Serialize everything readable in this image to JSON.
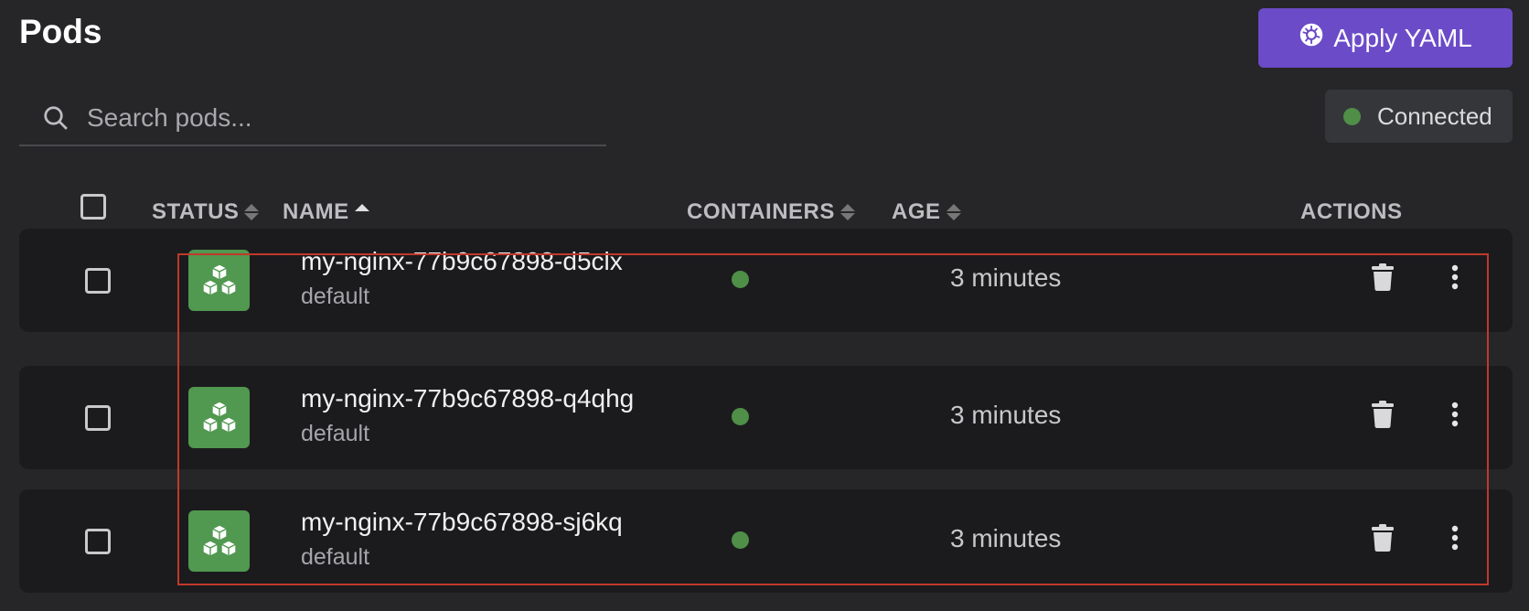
{
  "page": {
    "title": "Pods",
    "apply_button_label": "Apply YAML",
    "search_placeholder": "Search pods...",
    "connection_status": "Connected"
  },
  "colors": {
    "background": "#262628",
    "row_background": "#1b1b1d",
    "accent_purple": "#6b4bc8",
    "status_green": "#4f8f48",
    "pod_icon_green": "#519850",
    "highlight_red": "#c0392b"
  },
  "table": {
    "columns": {
      "status": "STATUS",
      "name": "NAME",
      "containers": "CONTAINERS",
      "age": "AGE",
      "actions": "ACTIONS"
    },
    "sorted_by": "name",
    "rows": [
      {
        "name": "my-nginx-77b9c67898-d5clx",
        "namespace": "default",
        "age": "3 minutes",
        "container_status": "running"
      },
      {
        "name": "my-nginx-77b9c67898-q4qhg",
        "namespace": "default",
        "age": "3 minutes",
        "container_status": "running"
      },
      {
        "name": "my-nginx-77b9c67898-sj6kq",
        "namespace": "default",
        "age": "3 minutes",
        "container_status": "running"
      }
    ]
  },
  "icons": [
    "kubernetes-icon",
    "search-icon",
    "pod-cubes-icon",
    "trash-icon",
    "more-vertical-icon"
  ]
}
